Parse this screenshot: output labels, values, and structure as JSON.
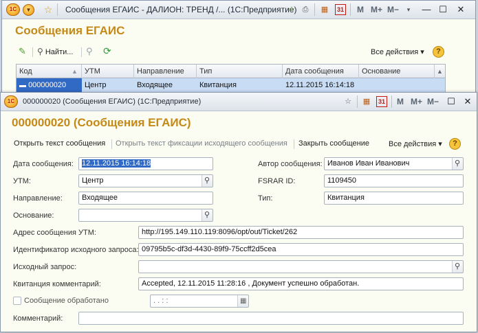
{
  "main_window": {
    "title": "Сообщения ЕГАИС - ДАЛИОН: ТРЕНД /...  (1С:Предприятие)",
    "heading": "Сообщения ЕГАИС",
    "toolbar": {
      "find_label": "Найти...",
      "all_actions": "Все действия ▾",
      "help": "?"
    },
    "title_marks": {
      "m": "M",
      "m_plus": "M+",
      "m_minus": "M−",
      "calendar": "31"
    },
    "table": {
      "columns": [
        "Код",
        "УТМ",
        "Направление",
        "Тип",
        "Дата сообщения",
        "Основание"
      ],
      "rows": [
        {
          "code": "000000020",
          "utm": "Центр",
          "direction": "Входящее",
          "type": "Квитанция",
          "date": "12.11.2015 16:14:18",
          "basis": ""
        }
      ]
    }
  },
  "detail_window": {
    "title": "000000020 (Сообщения ЕГАИС)  (1С:Предприятие)",
    "heading": "000000020 (Сообщения ЕГАИС)",
    "title_marks": {
      "m": "M",
      "m_plus": "M+",
      "m_minus": "M−",
      "calendar": "31"
    },
    "command_bar": {
      "open_text": "Открыть текст сообщения",
      "open_fix_text": "Открыть текст фиксации исходящего сообщения",
      "close_message": "Закрыть сообщение",
      "all_actions": "Все действия ▾",
      "help": "?"
    },
    "fields": {
      "date_label": "Дата сообщения:",
      "date_value": "12.11.2015 16:14:18",
      "author_label": "Автор сообщения:",
      "author_value": "Иванов Иван Иванович",
      "utm_label": "УТМ:",
      "utm_value": "Центр",
      "fsrar_label": "FSRAR ID:",
      "fsrar_value": "1109450",
      "direction_label": "Направление:",
      "direction_value": "Входящее",
      "type_label": "Тип:",
      "type_value": "Квитанция",
      "basis_label": "Основание:",
      "basis_value": "",
      "utm_address_label": "Адрес сообщения УТМ:",
      "utm_address_value": "http://195.149.110.119:8096/opt/out/Ticket/262",
      "request_id_label": "Идентификатор исходного запроса:",
      "request_id_value": "09795b5c-df3d-4430-89f9-75ccff2d5cea",
      "source_request_label": "Исходный запрос:",
      "source_request_value": "",
      "receipt_comment_label": "Квитанция комментарий:",
      "receipt_comment_value": "Accepted, 12.11.2015 11:28:16 , Документ успешно обработан.",
      "processed_label": "Сообщение обработано",
      "processed_date_value": " .  .     :  :",
      "comment_label": "Комментарий:",
      "comment_value": ""
    }
  }
}
